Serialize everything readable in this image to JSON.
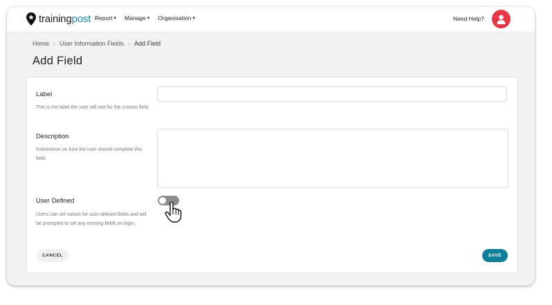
{
  "brand": {
    "name_part1": "training",
    "name_part2": "post"
  },
  "nav": {
    "items": [
      {
        "label": "Report"
      },
      {
        "label": "Manage"
      },
      {
        "label": "Organisation"
      }
    ],
    "help_label": "Need Help?"
  },
  "breadcrumb": [
    "Home",
    "User Information Fields",
    "Add Field"
  ],
  "page_title": "Add Field",
  "form": {
    "label": {
      "title": "Label",
      "help": "This is the label the user will see for the custom field.",
      "value": ""
    },
    "description": {
      "title": "Description",
      "help": "Instructions on how the user should complete this field.",
      "value": ""
    },
    "user_defined": {
      "title": "User Defined",
      "help": "Users can set values for user-defined fields and will be prompted to set any missing fields on login.",
      "enabled": false
    }
  },
  "actions": {
    "cancel_label": "CANCEL",
    "save_label": "SAVE"
  },
  "colors": {
    "brand_teal": "#1a8aa8",
    "save_button": "#137e99",
    "avatar": "#e53744",
    "toggle_off": "#8c8c8c"
  },
  "icons": {
    "logo": "map-pin-star-icon",
    "caret": "chevron-down-icon",
    "breadcrumb_sep": "chevron-right-icon",
    "avatar": "user-icon",
    "cursor": "hand-pointer-icon"
  }
}
